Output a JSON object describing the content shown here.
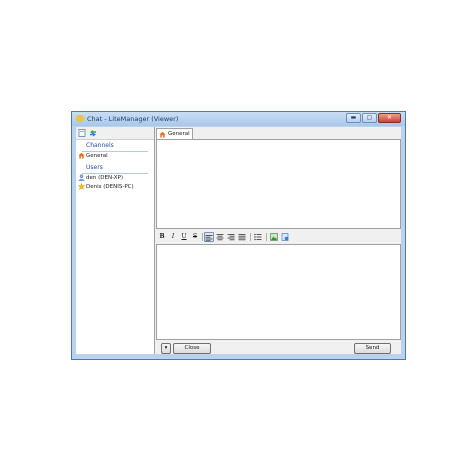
{
  "window": {
    "title": "Chat - LiteManager (Viewer)"
  },
  "titlebar_buttons": {
    "minimize": "▬",
    "maximize": "▢",
    "close": "✕"
  },
  "left_panel": {
    "channels_header": "Channels",
    "channels": [
      {
        "label": "General",
        "icon": "house-icon"
      }
    ],
    "users_header": "Users",
    "users": [
      {
        "label": "den (DEN-XP)",
        "icon": "user-icon"
      },
      {
        "label": "Denis (DENIS-PC)",
        "icon": "star-icon"
      }
    ]
  },
  "tabs": [
    {
      "label": "General",
      "icon": "house-icon"
    }
  ],
  "format_toolbar": {
    "bold": "B",
    "italic": "I",
    "underline": "U",
    "strike": "S"
  },
  "bottom_bar": {
    "dropdown": "▾",
    "close_label": "Close",
    "send_label": "Send"
  },
  "colors": {
    "titlebar": "#b9d3ee",
    "header_text": "#1f4e9a",
    "window_border": "#4e79a8"
  }
}
